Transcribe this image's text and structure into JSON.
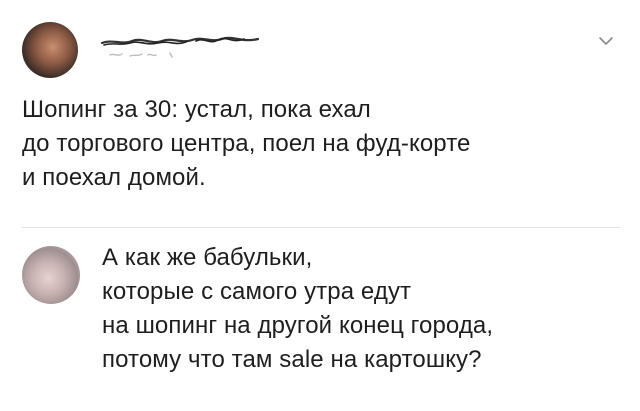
{
  "tweet": {
    "text": "Шопинг за 30: устал, пока ехал\nдо торгового центра, поел на фуд-корте\nи поехал домой."
  },
  "reply": {
    "text": "А как же бабульки,\nкоторые с самого утра едут\nна шопинг на другой конец города,\nпотому что там sale на картошку?"
  },
  "icons": {
    "menu": "chevron-down-icon"
  },
  "colors": {
    "text": "#1e1e1e",
    "divider": "#e3e3e3",
    "chevron": "#8a8a8a"
  }
}
